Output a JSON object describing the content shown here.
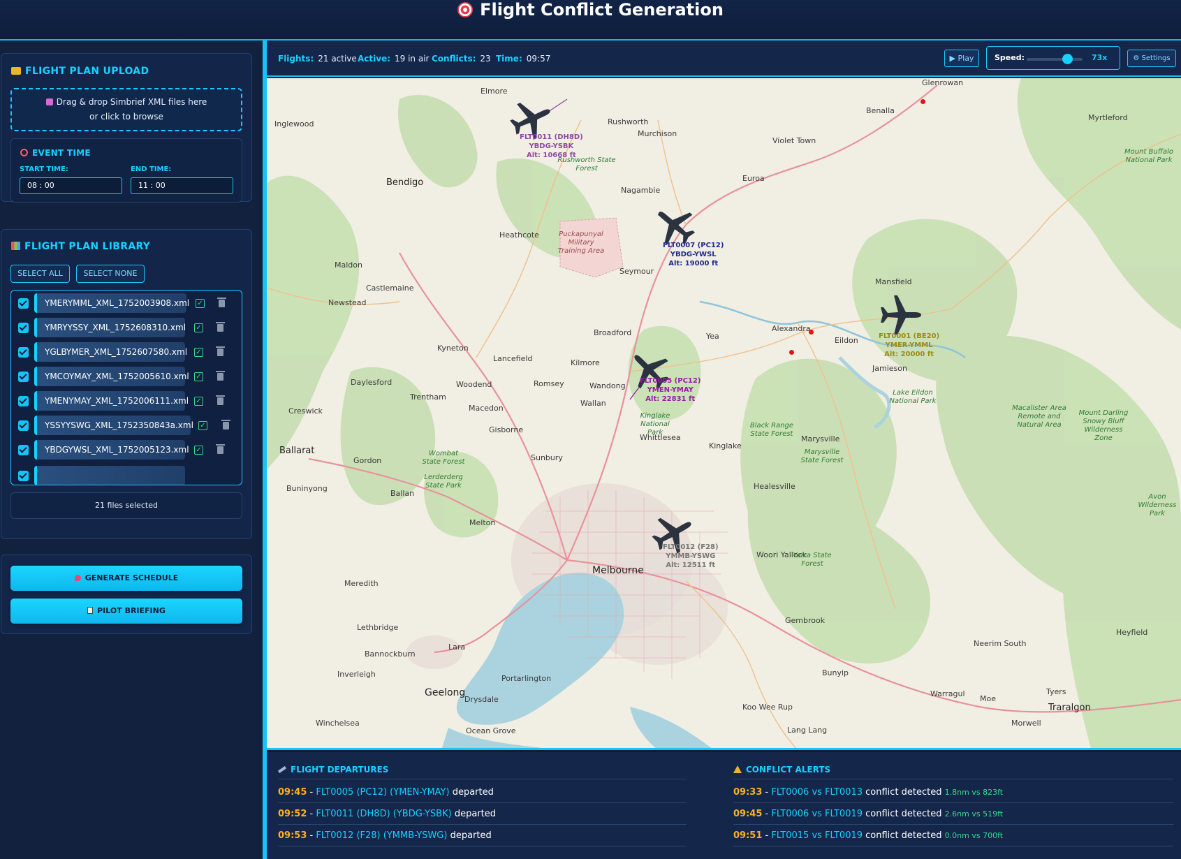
{
  "header": {
    "title": "Flight Conflict Generation",
    "icon": "target-icon"
  },
  "upload": {
    "title": "FLIGHT PLAN UPLOAD",
    "drop_line1": "Drag & drop Simbrief XML files here",
    "drop_line2": "or click to browse"
  },
  "event_time": {
    "title": "EVENT TIME",
    "start_label": "START TIME:",
    "start_value": "08 : 00",
    "end_label": "END TIME:",
    "end_value": "11 : 00"
  },
  "library": {
    "title": "FLIGHT PLAN LIBRARY",
    "select_all": "SELECT ALL",
    "select_none": "SELECT NONE",
    "files": [
      "YMERYMML_XML_1752003908.xml",
      "YMRYYSSY_XML_1752608310.xml",
      "YGLBYMER_XML_1752607580.xml",
      "YMCOYMAY_XML_1752005610.xml",
      "YMENYMAY_XML_1752006111.xml",
      "YSSYYSWG_XML_1752350843a.xml",
      "YBDGYWSL_XML_1752005123.xml"
    ],
    "selected_text": "21 files selected"
  },
  "actions": {
    "generate": "GENERATE SCHEDULE",
    "briefing": "PILOT BRIEFING"
  },
  "status": {
    "flights_label": "Flights:",
    "flights_value": "21 active",
    "active_label": "Active:",
    "active_value": "19 in air",
    "conflicts_label": "Conflicts:",
    "conflicts_value": "23",
    "time_label": "Time:",
    "time_value": "09:57",
    "play": "▶ Play",
    "speed_label": "Speed:",
    "speed_value": "73x",
    "speed_fraction": 0.72,
    "settings": "⚙ Settings"
  },
  "map": {
    "places": [
      "Glenrowan",
      "Elmore",
      "Benalla",
      "Myrtleford",
      "Inglewood",
      "Rushworth",
      "Murchison",
      "Violet Town",
      "Bendigo",
      "Euroa",
      "Nagambie",
      "Heathcote",
      "Maldon",
      "Seymour",
      "Castlemaine",
      "Mansfield",
      "Newstead",
      "Broadford",
      "Yea",
      "Alexandra",
      "Eildon",
      "Kyneton",
      "Lancefield",
      "Kilmore",
      "Jamieson",
      "Daylesford",
      "Woodend",
      "Romsey",
      "Wandong",
      "Trentham",
      "Creswick",
      "Macedon",
      "Wallan",
      "Gisborne",
      "Whittlesea",
      "Kinglake",
      "Marysville",
      "Ballarat",
      "Gordon",
      "Sunbury",
      "Ballan",
      "Healesville",
      "Buninyong",
      "Melton",
      "Woori Yallock",
      "Meredith",
      "Gembrook",
      "Lethbridge",
      "Heyfield",
      "Neerim South",
      "Lara",
      "Bannockburn",
      "Bunyip",
      "Inverleigh",
      "Portarlington",
      "Warragul",
      "Tyers",
      "Drysdale",
      "Moe",
      "Winchelsea",
      "Koo Wee Rup",
      "Morwell",
      "Ocean Grove",
      "Lang Lang",
      "Geelong",
      "Melbourne",
      "Traralgon"
    ],
    "parks": [
      "Mount Buffalo National Park",
      "Rushworth State Forest",
      "Lake Eildon National Park",
      "Macalister Area Remote and Natural Area",
      "Mount Darling Snowy Bluff Wilderness Zone",
      "Black Range State Forest",
      "Marysville State Forest",
      "Wombat State Forest",
      "Lerderderg State Park",
      "Kinglake National Park",
      "Avon Wilderness Park",
      "Yarra State Forest"
    ],
    "military": "Puckapunyal Military Training Area",
    "flights": [
      {
        "line1": "FLT0011 (DH8D)",
        "line2": "YBDG-YSBK",
        "line3": "Alt: 10668 ft",
        "color": "#8e4aa3"
      },
      {
        "line1": "FLT0007 (PC12)",
        "line2": "YBDG-YWSL",
        "line3": "Alt: 19000 ft",
        "color": "#1f2a8c"
      },
      {
        "line1": "FLT0001 (BE20)",
        "line2": "YMER-YMML",
        "line3": "Alt: 20000 ft",
        "color": "#9a8a16"
      },
      {
        "line1": "FLT0005 (PC12)",
        "line2": "YMEN-YMAY",
        "line3": "Alt: 22831 ft",
        "color": "#9a1aa8"
      },
      {
        "line1": "FLT0012 (F28)",
        "line2": "YMMB-YSWG",
        "line3": "Alt: 12511 ft",
        "color": "#777777"
      }
    ]
  },
  "departures": {
    "title": "FLIGHT DEPARTURES",
    "items": [
      {
        "time": "09:45",
        "flight": "FLT0005 (PC12) (YMEN-YMAY)",
        "text": "departed"
      },
      {
        "time": "09:52",
        "flight": "FLT0011 (DH8D) (YBDG-YSBK)",
        "text": "departed"
      },
      {
        "time": "09:53",
        "flight": "FLT0012 (F28) (YMMB-YSWG)",
        "text": "departed"
      }
    ]
  },
  "conflicts": {
    "title": "CONFLICT ALERTS",
    "items": [
      {
        "time": "09:33",
        "pair": "FLT0006 vs FLT0013",
        "text": "conflict detected",
        "detail": "1.8nm vs 823ft"
      },
      {
        "time": "09:45",
        "pair": "FLT0006 vs FLT0019",
        "text": "conflict detected",
        "detail": "2.6nm vs 519ft"
      },
      {
        "time": "09:51",
        "pair": "FLT0015 vs FLT0019",
        "text": "conflict detected",
        "detail": "0.0nm vs 700ft"
      }
    ]
  },
  "colors": {
    "accent": "#17d1ff",
    "background": "#0f1c34",
    "time": "#ffb020",
    "ok": "#39d98a"
  }
}
